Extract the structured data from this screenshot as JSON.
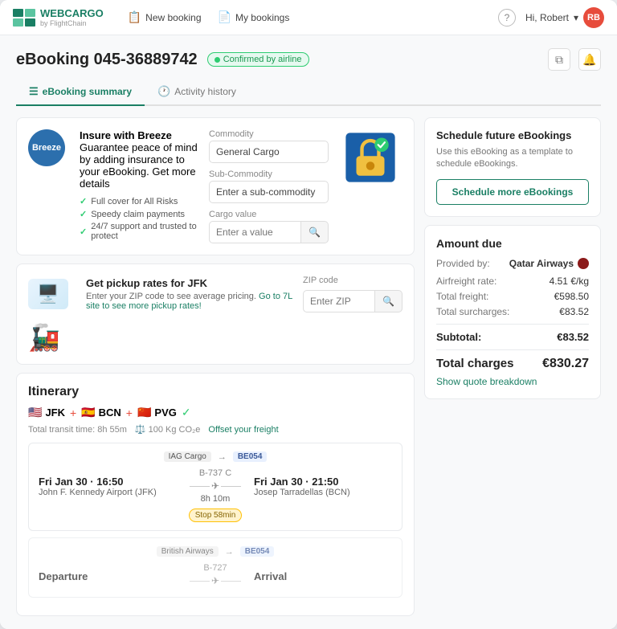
{
  "nav": {
    "logo_text": "WEBCARGO",
    "logo_sub": "by FlightChain",
    "new_booking": "New booking",
    "my_bookings": "My bookings",
    "greeting": "Hi, Robert",
    "user_initials": "RB"
  },
  "header": {
    "booking_id": "eBooking 045-36889742",
    "status": "Confirmed by airline",
    "copy_tooltip": "Copy",
    "bell_tooltip": "Notifications"
  },
  "tabs": {
    "ebooking_summary": "eBooking summary",
    "activity_history": "Activity history"
  },
  "insure_card": {
    "logo": "Breeze",
    "title": "Insure with Breeze",
    "description": "Guarantee peace of mind by adding insurance to your eBooking.",
    "link": "Get more details",
    "checks": [
      "Full cover for All Risks",
      "Speedy claim payments",
      "24/7 support and trusted to protect"
    ],
    "commodity_label": "Commodity",
    "commodity_placeholder": "General Cargo",
    "sub_commodity_label": "Sub-Commodity",
    "sub_commodity_placeholder": "Enter a sub-commodity",
    "cargo_value_label": "Cargo value",
    "cargo_value_placeholder": "Enter a value"
  },
  "pickup_card": {
    "title": "Get pickup rates for JFK",
    "description": "Enter your ZIP code to see average pricing.",
    "link": "Go to 7L site to see more pickup rates!",
    "zip_label": "ZIP code",
    "zip_placeholder": "Enter ZIP"
  },
  "itinerary": {
    "title": "Itinerary",
    "routes": [
      {
        "flag": "🇺🇸",
        "code": "JFK"
      },
      {
        "flag": "🇪🇸",
        "code": "BCN"
      },
      {
        "flag": "🇨🇳",
        "code": "PVG"
      }
    ],
    "transit_time": "Total transit time: 8h 55m",
    "weight": "100 Kg CO₂e",
    "offer_link": "Offset your freight",
    "segments": [
      {
        "carrier_logo": "IAG Cargo",
        "flight_num": "B-737 C",
        "duration": "8h 10m",
        "dep_time": "Fri Jan 30 · 16:50",
        "dep_airport": "John F. Kennedy Airport (JFK)",
        "arr_time": "Fri Jan 30 · 21:50",
        "arr_airport": "Josep Tarradellas (BCN)",
        "stop_label": "Stop 58min",
        "badge": "BE054"
      },
      {
        "carrier_logo": "British Airways",
        "flight_num": "B-727",
        "duration": "",
        "dep_time": "Departure",
        "dep_airport": "",
        "arr_time": "Arrival",
        "arr_airport": "",
        "stop_label": "",
        "badge": "BE054"
      }
    ]
  },
  "schedule_card": {
    "title": "Schedule future eBookings",
    "description": "Use this eBooking as a template to schedule eBookings.",
    "button": "Schedule more eBookings"
  },
  "amount_card": {
    "title": "Amount due",
    "provided_by_label": "Provided by:",
    "provider": "Qatar Airways",
    "airfreight_label": "Airfreight rate:",
    "airfreight_value": "4.51 €/kg",
    "total_freight_label": "Total freight:",
    "total_freight_value": "€598.50",
    "total_surcharges_label": "Total surcharges:",
    "total_surcharges_value": "€83.52",
    "subtotal_label": "Subtotal:",
    "subtotal_value": "€83.52",
    "total_label": "Total charges",
    "total_value": "€830.27",
    "quote_link": "Show quote breakdown"
  }
}
